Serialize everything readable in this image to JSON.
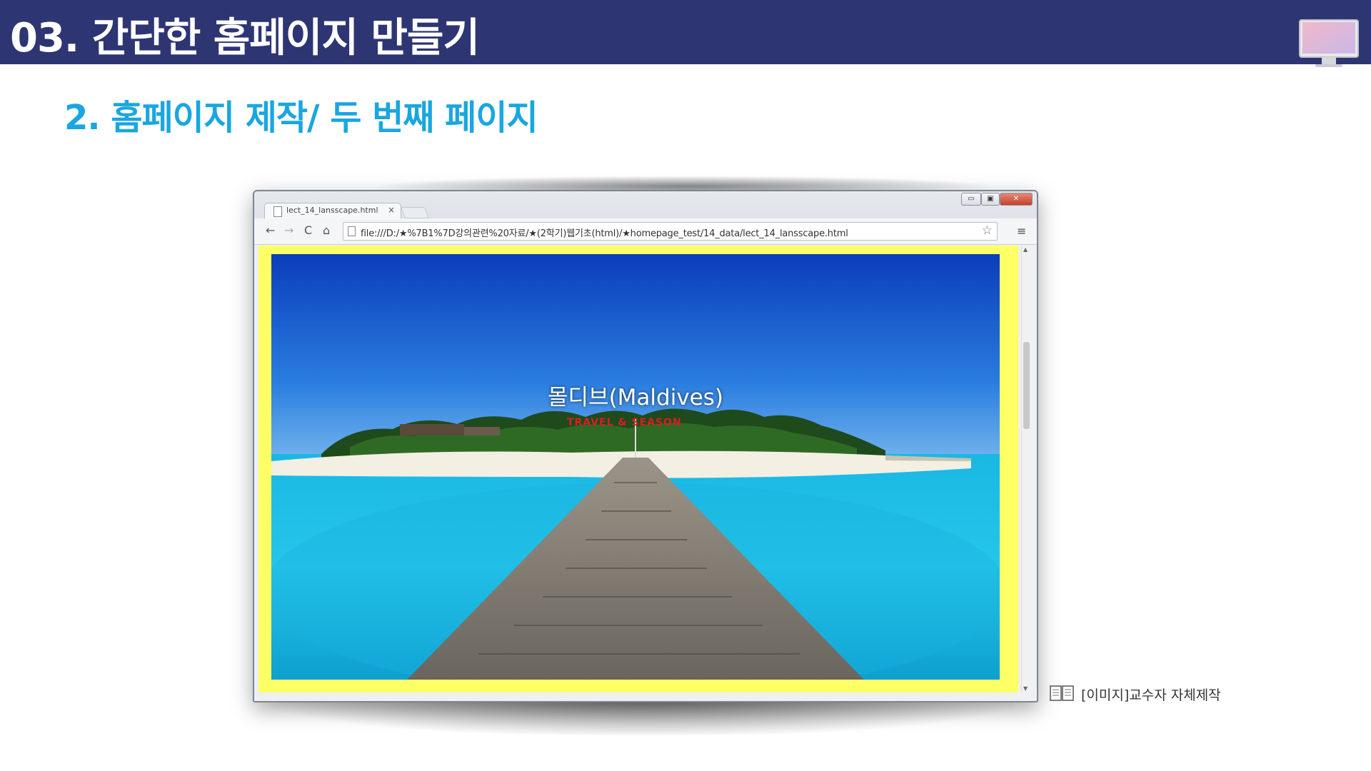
{
  "header": {
    "title": "03. 간단한 홈페이지 만들기",
    "icon": "monitor-icon"
  },
  "subtitle": "2. 홈페이지 제작/ 두 번째 페이지",
  "browser": {
    "tab_title": "lect_14_lansscape.html",
    "tab_close": "×",
    "url": "file:///D:/★%7B1%7D강의관련%20자료/★(2학기)웹기초(html)/★homepage_test/14_data/lect_14_lansscape.html",
    "window_buttons": {
      "minimize": "▭",
      "maximize": "▣",
      "close": "✕"
    },
    "nav": {
      "back": "←",
      "forward": "→",
      "reload": "C",
      "home": "⌂",
      "star": "☆",
      "menu": "≡"
    },
    "page_background": "#ffff66"
  },
  "page": {
    "heading": "몰디브(Maldives)",
    "subtext": "TRAVEL & SEASON",
    "image": "maldives-island-pier"
  },
  "caption": {
    "text": "[이미지]교수자 자체제작",
    "icon": "book-icon"
  },
  "colors": {
    "header_bg": "#2e3573",
    "subtitle": "#1aa6e0"
  }
}
